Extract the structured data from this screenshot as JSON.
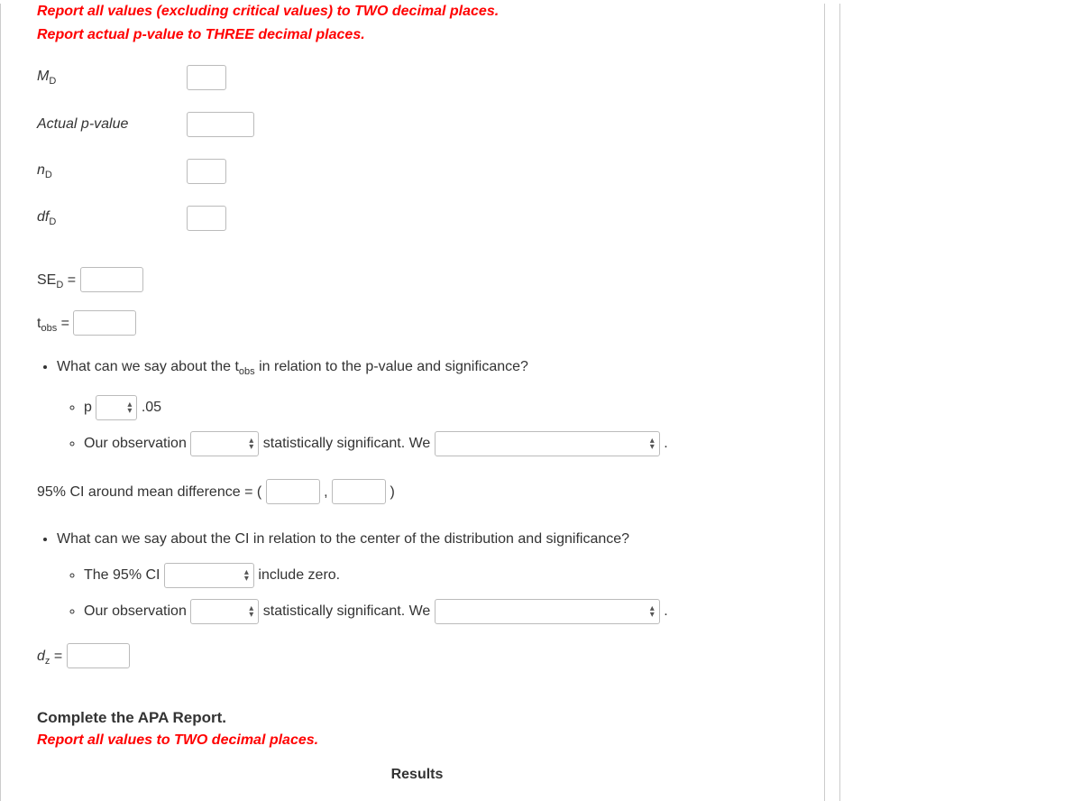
{
  "instructions": {
    "line1": "Report all values (excluding critical values) to TWO decimal places.",
    "line2": "Report actual p-value to THREE decimal places."
  },
  "fields": {
    "md_label_base": "M",
    "md_sub": "D",
    "pval_label": "Actual p-value",
    "nd_base": "n",
    "nd_sub": "D",
    "dfd_base": "df",
    "dfd_sub": "D",
    "sed_base": "SE",
    "sed_sub": "D",
    "eq": " = ",
    "tobs_base": "t",
    "tobs_sub": "obs"
  },
  "q1": {
    "prompt_pre": "What can we say about the t",
    "prompt_sub": "obs",
    "prompt_post": " in relation to the p-value and significance?",
    "p_label": "p",
    "alpha": ".05",
    "obs_pre": "Our observation",
    "obs_mid": "statistically significant. We",
    "period": "."
  },
  "ci": {
    "label": "95% CI around mean difference = (",
    "comma": ", ",
    "close": ")"
  },
  "q2": {
    "prompt": "What can we say about the CI in relation to the center of the distribution and significance?",
    "ci_pre": "The 95% CI",
    "ci_post": "include zero.",
    "obs_pre": "Our observation",
    "obs_mid": "statistically significant. We",
    "period": "."
  },
  "dz": {
    "base": "d",
    "sub": "z",
    "eq": " = "
  },
  "apa": {
    "heading": "Complete the APA Report.",
    "instr": "Report all values to TWO decimal places.",
    "results": "Results"
  }
}
